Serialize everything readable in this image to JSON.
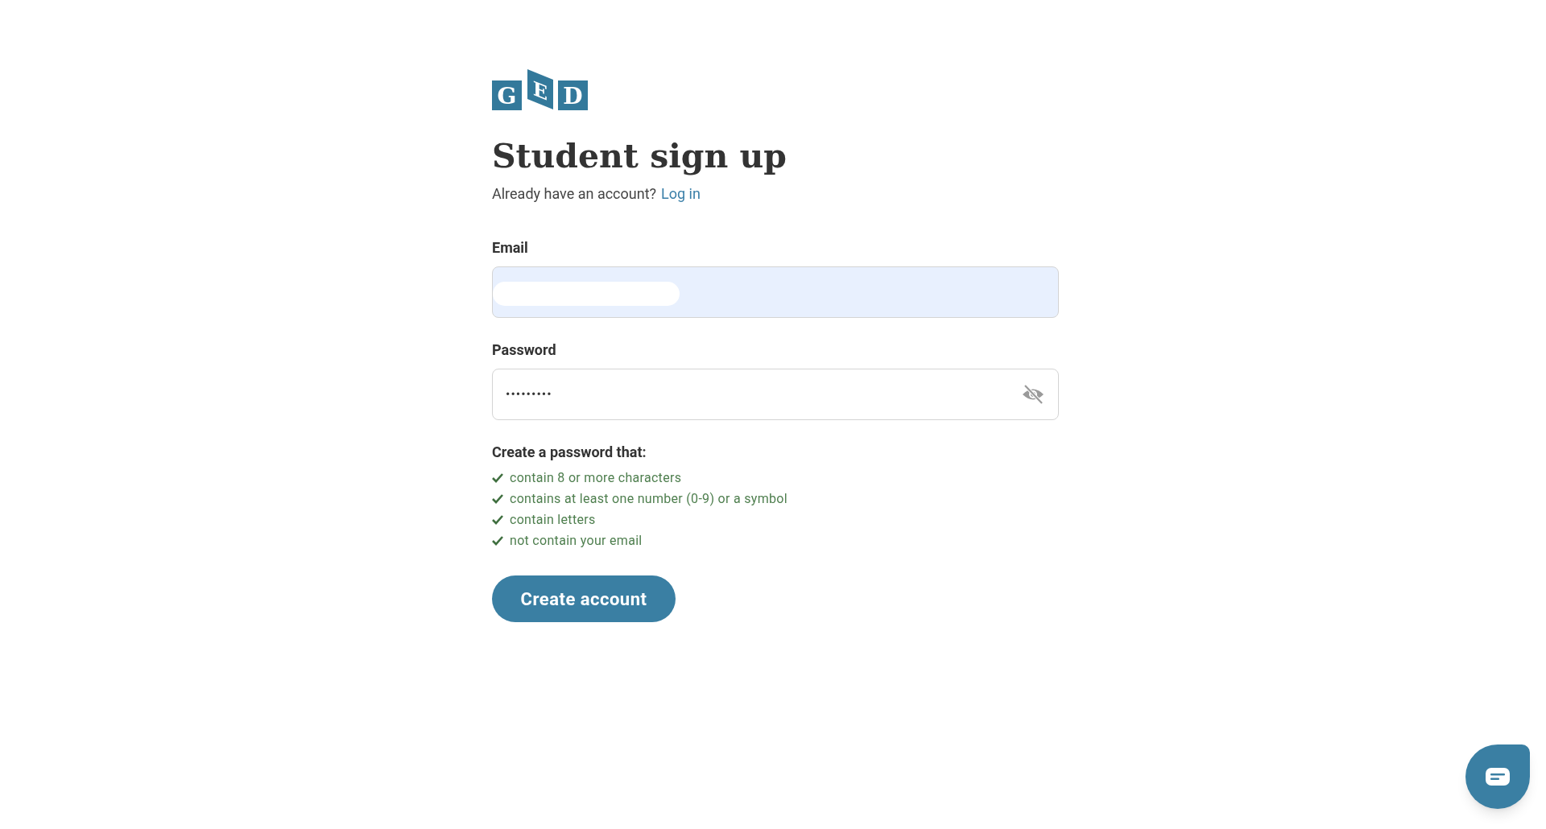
{
  "logo": {
    "letters": [
      "G",
      "E",
      "D"
    ]
  },
  "title": "Student sign up",
  "login_prompt": {
    "text": "Already have an account?",
    "link": "Log in"
  },
  "email": {
    "label": "Email",
    "autofilled": true,
    "redacted": true
  },
  "password": {
    "label": "Password",
    "value": "•••••••••",
    "visible": false
  },
  "requirements": {
    "heading": "Create a password that:",
    "items": [
      {
        "text": "contain 8 or more characters",
        "met": true
      },
      {
        "text": "contains at least one number (0-9) or a symbol",
        "met": true
      },
      {
        "text": "contain letters",
        "met": true
      },
      {
        "text": "not contain your email",
        "met": true
      }
    ]
  },
  "submit": "Create account"
}
